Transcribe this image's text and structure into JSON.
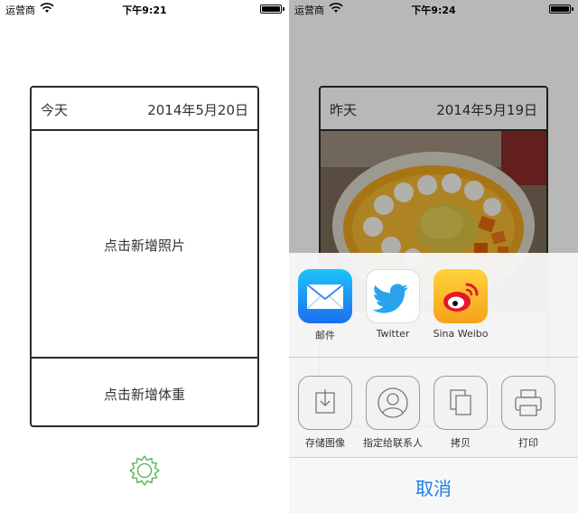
{
  "left": {
    "status": {
      "carrier": "运营商",
      "time": "下午9:21"
    },
    "card": {
      "day": "今天",
      "date": "2014年5月20日",
      "add_photo": "点击新增照片",
      "add_weight": "点击新增体重"
    },
    "settings_icon": "gear-icon"
  },
  "right": {
    "status": {
      "carrier": "运营商",
      "time": "下午9:24"
    },
    "card": {
      "day": "昨天",
      "date": "2014年5月19日"
    },
    "share_apps": [
      {
        "label": "邮件",
        "icon": "mail-icon",
        "color": "#1e7ff0"
      },
      {
        "label": "Twitter",
        "icon": "twitter-icon",
        "color": "#2aa3ef"
      },
      {
        "label": "Sina Weibo",
        "icon": "weibo-icon",
        "color": "#f5a623"
      }
    ],
    "actions": [
      {
        "label": "存储图像",
        "icon": "save-image-icon"
      },
      {
        "label": "指定给联系人",
        "icon": "assign-contact-icon"
      },
      {
        "label": "拷贝",
        "icon": "copy-icon"
      },
      {
        "label": "打印",
        "icon": "print-icon"
      }
    ],
    "cancel": "取消"
  },
  "colors": {
    "accent": "#1a7ee8",
    "settings_green": "#4caf50",
    "card_border": "#2b2b2b"
  }
}
